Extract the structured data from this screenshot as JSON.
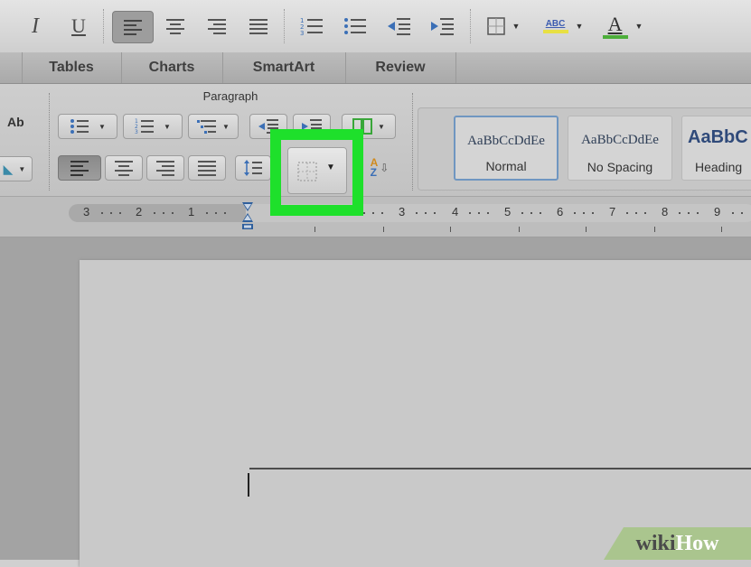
{
  "toolbar": {
    "italic_label": "I",
    "underline_label": "U",
    "font_color_label": "A",
    "highlight_label": "ABC"
  },
  "ribbon_tabs": [
    "Tables",
    "Charts",
    "SmartArt",
    "Review"
  ],
  "ribbon": {
    "group_label": "Paragraph",
    "sort_label_a": "A",
    "sort_label_z": "Z",
    "change_case_label": "Ab"
  },
  "styles": [
    {
      "preview": "AaBbCcDdEe",
      "name": "Normal",
      "selected": true
    },
    {
      "preview": "AaBbCcDdEe",
      "name": "No Spacing",
      "selected": false
    },
    {
      "preview": "AaBbC",
      "name": "Heading",
      "selected": false
    }
  ],
  "ruler": {
    "labels": [
      "3",
      "2",
      "1",
      "1",
      "2",
      "3",
      "4",
      "5",
      "6",
      "7",
      "8",
      "9"
    ]
  },
  "watermark": {
    "wiki": "wiki",
    "how": "How"
  },
  "colors": {
    "highlight": "#1ee02b",
    "selected_style_border": "#6f96c1",
    "watermark_bg": "#aac58e"
  }
}
